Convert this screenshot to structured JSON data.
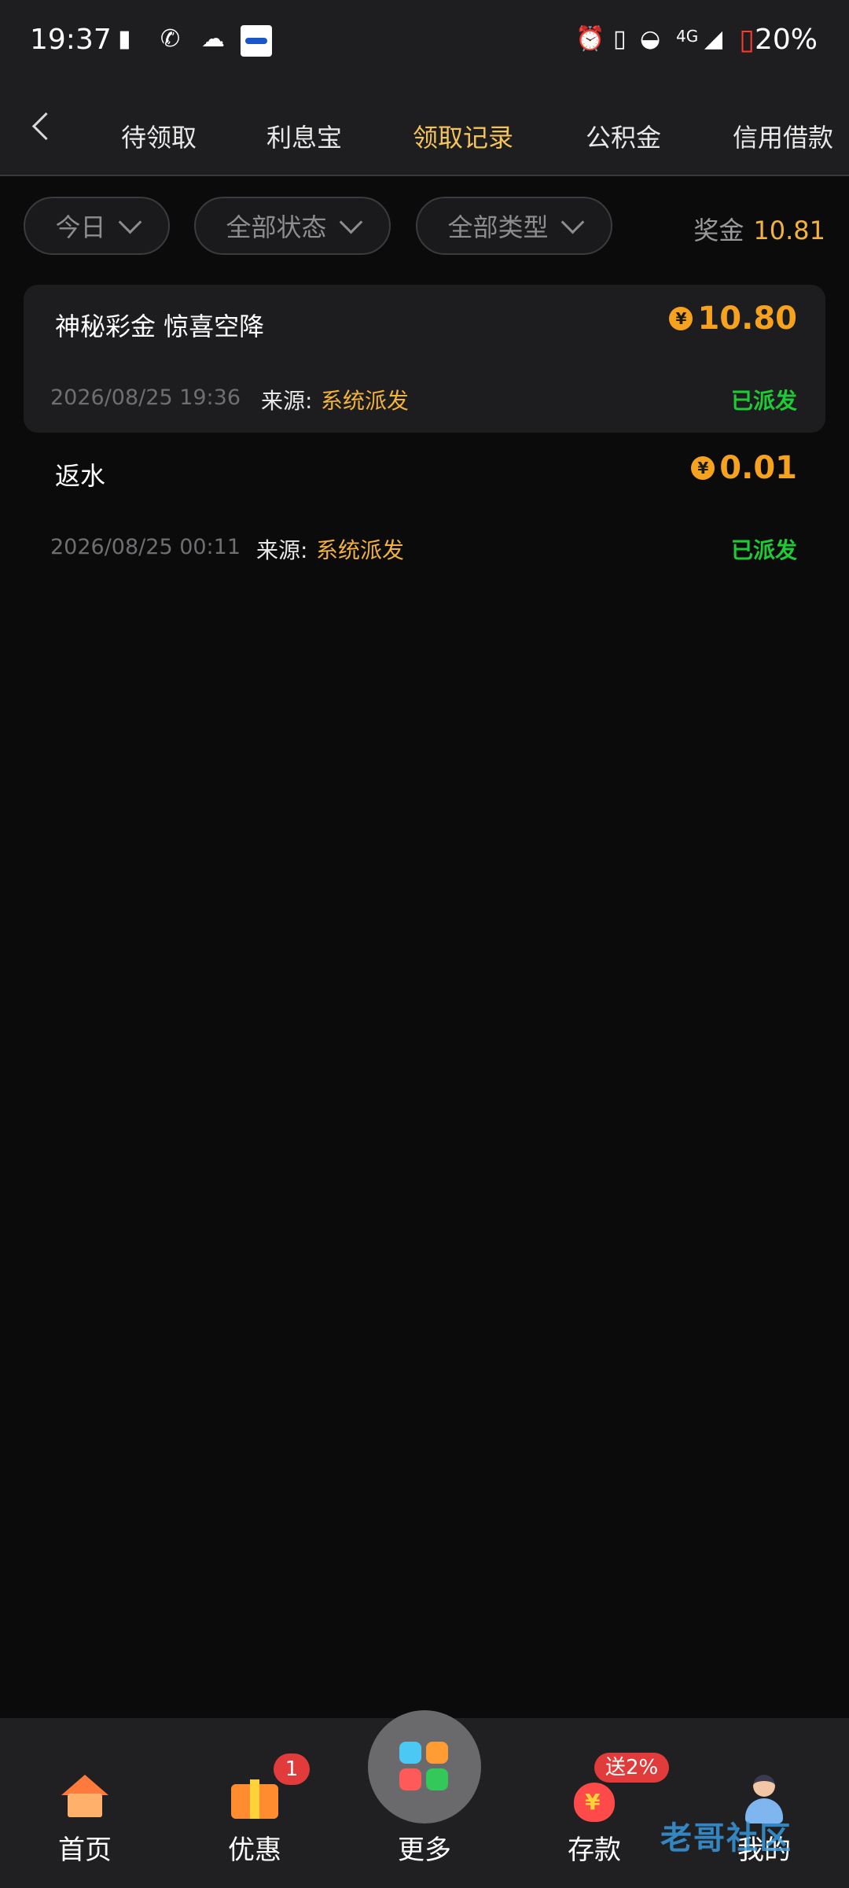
{
  "status_bar": {
    "time": "19:37",
    "network": "4G",
    "battery": "20%"
  },
  "nav": {
    "back_icon": "chevron-left-icon",
    "tabs": [
      {
        "label": "待领取"
      },
      {
        "label": "利息宝"
      },
      {
        "label": "领取记录",
        "active": true
      },
      {
        "label": "公积金"
      },
      {
        "label": "信用借款"
      }
    ]
  },
  "filters": {
    "date": "今日",
    "status": "全部状态",
    "type": "全部类型",
    "bonus_label": "奖金",
    "bonus_value": "10.81"
  },
  "records": [
    {
      "title": "神秘彩金  惊喜空降",
      "amount": "10.80",
      "date": "2026/08/25 19:36",
      "source_label": "来源:",
      "source": "系统派发",
      "status": "已派发"
    },
    {
      "title": "返水",
      "amount": "0.01",
      "date": "2026/08/25 00:11",
      "source_label": "来源:",
      "source": "系统派发",
      "status": "已派发"
    }
  ],
  "currency_symbol": "¥",
  "bottom_nav": {
    "home": "首页",
    "promo": "优惠",
    "promo_badge": "1",
    "more": "更多",
    "deposit": "存款",
    "deposit_badge": "送2%",
    "mine": "我的"
  },
  "watermark": "老哥社区",
  "colors": {
    "accent_gold": "#f3b23c",
    "amount_orange": "#f6a21e",
    "status_green": "#1ecb35",
    "badge_red": "#e23b3b"
  }
}
